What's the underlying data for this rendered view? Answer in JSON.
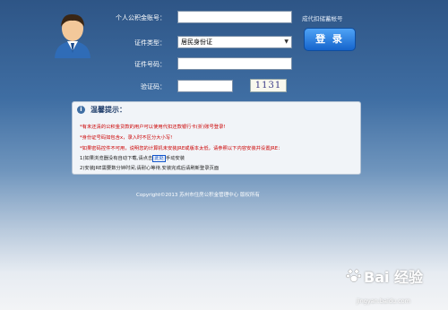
{
  "login_form": {
    "account_label": "个人公积金账号：",
    "account_value": "",
    "proxy_link": "成代扣储蓄帐号",
    "id_type_label": "证件类型：",
    "id_type_selected": "居民身份证",
    "id_number_label": "证件号码：",
    "id_number_value": "",
    "captcha_label": "验证码：",
    "captcha_value": "",
    "captcha_text": "1131",
    "login_button": "登 录"
  },
  "notice": {
    "title": "温馨提示：",
    "lines": [
      "*有未还清的公积金贷款的用户可以使用代扣还款银行卡(折)账号登录!",
      "*身份证号码如包含x，录入时不区分大小写!",
      "*如果密码控件不可用，说明您的计算机未安装JRE或版本太低，请参照以下内容安装并设置JRE：",
      "1)如果浏览器没有自动下载,请点击",
      "此处",
      "手动安装",
      "2)安装JRE需要数分钟时间,请耐心等待,安装完成后请刷新登录页面"
    ]
  },
  "footer": {
    "copyright": "Copyright©2013  苏州市住房公积金管理中心  版权所有"
  },
  "watermark": {
    "main": "Bai 经验",
    "sub": "jingyan.baidu.com"
  },
  "colors": {
    "accent": "#1564cc",
    "background_top": "#2e5586",
    "notice_title": "#25426e"
  }
}
